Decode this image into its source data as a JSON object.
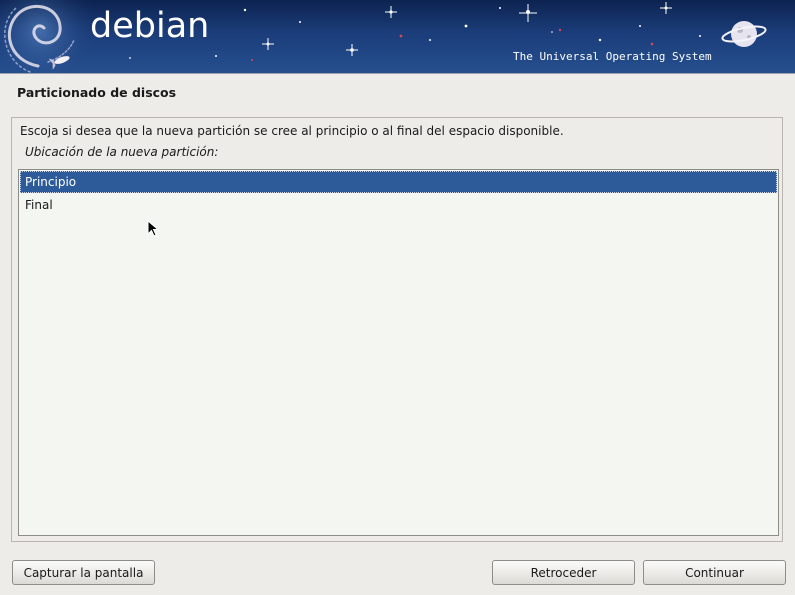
{
  "banner": {
    "brand": "debian",
    "tagline": "The Universal Operating System",
    "logo_icon": "debian-swirl-icon",
    "planet_icon": "planet-icon"
  },
  "page": {
    "title": "Particionado de discos",
    "question": "Escoja si desea que la nueva partición se cree al principio o al final del espacio disponible.",
    "list_label": "Ubicación de la nueva partición:"
  },
  "options": [
    {
      "label": "Principio",
      "selected": true
    },
    {
      "label": "Final",
      "selected": false
    }
  ],
  "buttons": {
    "capture": "Capturar la pantalla",
    "back": "Retroceder",
    "continue": "Continuar"
  },
  "colors": {
    "banner": "#1b3d7a",
    "selection": "#2d5a98",
    "background": "#edece8"
  }
}
